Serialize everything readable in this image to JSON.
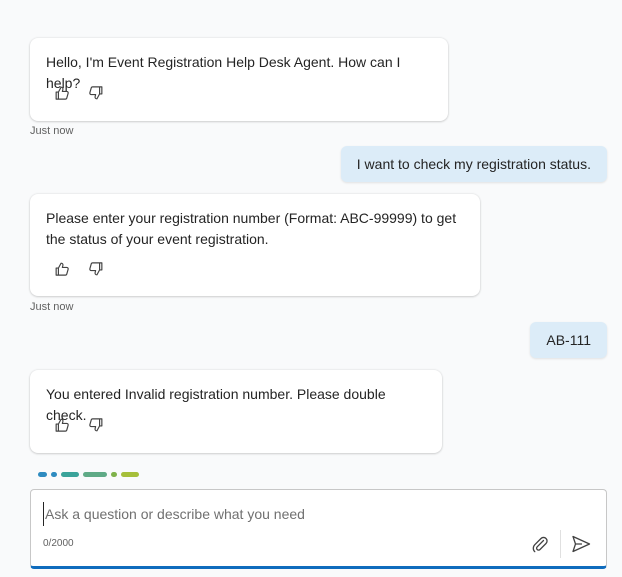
{
  "messages": [
    {
      "role": "bot",
      "text": "Hello, I'm Event Registration Help Desk Agent. How can I help?",
      "timestamp": "Just now"
    },
    {
      "role": "user",
      "text": "I want to check my registration status."
    },
    {
      "role": "bot",
      "text": "Please enter your registration number (Format: ABC-99999) to get the status of your event registration.",
      "timestamp": "Just now"
    },
    {
      "role": "user",
      "text": "AB-111"
    },
    {
      "role": "bot",
      "text": "You entered Invalid registration number. Please double check."
    }
  ],
  "typing_indicator": {
    "colors": [
      "#2e8bc0",
      "#2e8bc0",
      "#3aa39a",
      "#5faa86",
      "#7fb24a",
      "#a6bf3a"
    ]
  },
  "composer": {
    "placeholder": "Ask a question or describe what you need",
    "value": "",
    "counter": "0/2000"
  },
  "icons": {
    "like": "thumbs-up-icon",
    "dislike": "thumbs-down-icon",
    "attach": "paperclip-icon",
    "send": "send-icon"
  },
  "colors": {
    "user_bubble": "#dcecf8",
    "accent": "#0f6cbd"
  }
}
